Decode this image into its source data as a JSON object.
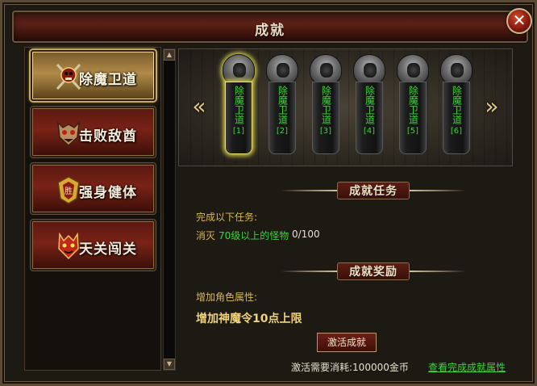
{
  "window": {
    "title": "成就",
    "close_label": "✕"
  },
  "categories": [
    {
      "label": "除魔卫道",
      "icon": "crossed-swords-skull-icon",
      "selected": true
    },
    {
      "label": "击败敌酋",
      "icon": "demon-mask-icon",
      "selected": false
    },
    {
      "label": "强身健体",
      "icon": "strength-crest-icon",
      "selected": false
    },
    {
      "label": "天关闯关",
      "icon": "red-demon-icon",
      "selected": false
    }
  ],
  "banner": {
    "prev_label": "«",
    "next_label": "»",
    "tiers": [
      {
        "text": "除魔卫道",
        "index": "[1]",
        "active": true
      },
      {
        "text": "除魔卫道",
        "index": "[2]",
        "active": false
      },
      {
        "text": "除魔卫道",
        "index": "[3]",
        "active": false
      },
      {
        "text": "除魔卫道",
        "index": "[4]",
        "active": false
      },
      {
        "text": "除魔卫道",
        "index": "[5]",
        "active": false
      },
      {
        "text": "除魔卫道",
        "index": "[6]",
        "active": false
      }
    ]
  },
  "task": {
    "header": "成就任务",
    "intro": "完成以下任务:",
    "objective_prefix": "消灭",
    "objective_detail": "70级以上的怪物",
    "progress": "0/100"
  },
  "reward": {
    "header": "成就奖励",
    "intro": "增加角色属性:",
    "value": "增加神魔令10点上限"
  },
  "footer": {
    "activate_label": "激活成就",
    "cost_text": "激活需要消耗:100000金币",
    "view_link": "查看完成成就属性"
  },
  "colors": {
    "accent_green": "#3fd23a",
    "accent_gold": "#d8b85a",
    "title_bar": "#5c2018"
  }
}
